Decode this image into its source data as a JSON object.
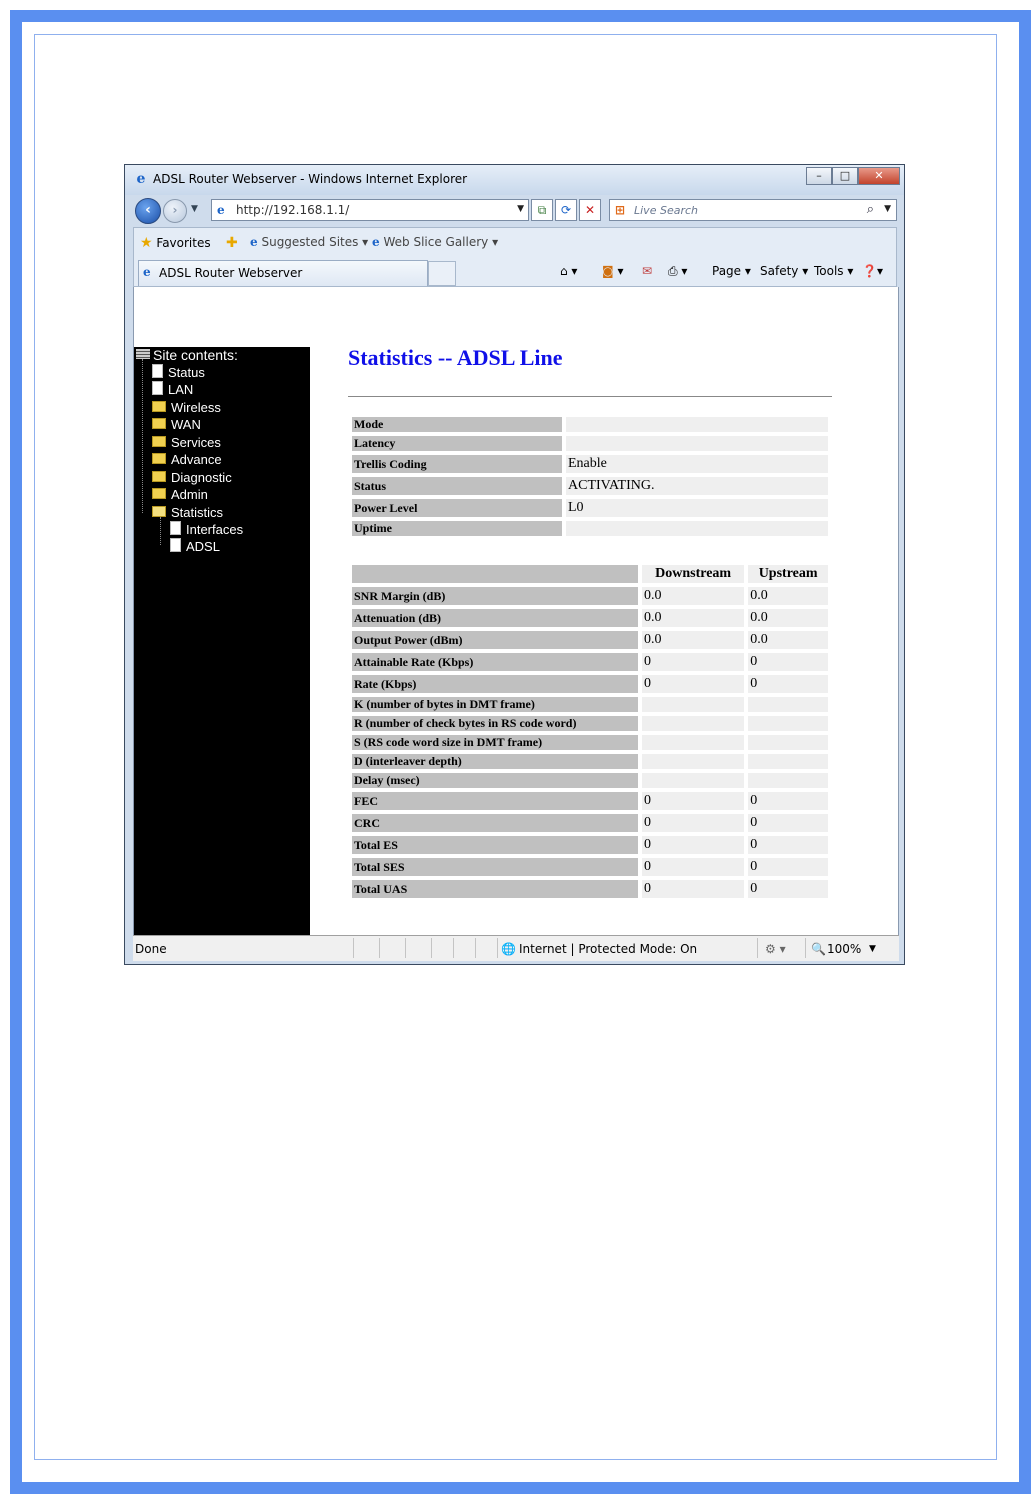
{
  "window": {
    "title": "ADSL Router Webserver - Windows Internet Explorer",
    "controls": {
      "minimize": "–",
      "maximize": "□",
      "close": "✕"
    }
  },
  "nav": {
    "address": "http://192.168.1.1/",
    "search_placeholder": "Live Search"
  },
  "favorites": {
    "favorites_label": "Favorites",
    "suggested_sites": "Suggested Sites ▾",
    "web_slice_gallery": "Web Slice Gallery ▾",
    "tab_title": "ADSL Router Webserver"
  },
  "commandbar": {
    "page": "Page ▾",
    "safety": "Safety ▾",
    "tools": "Tools ▾"
  },
  "sidebar": {
    "header": "Site contents:",
    "items": [
      {
        "label": "Status",
        "icon": "document"
      },
      {
        "label": "LAN",
        "icon": "document"
      },
      {
        "label": "Wireless",
        "icon": "folder"
      },
      {
        "label": "WAN",
        "icon": "folder"
      },
      {
        "label": "Services",
        "icon": "folder"
      },
      {
        "label": "Advance",
        "icon": "folder"
      },
      {
        "label": "Diagnostic",
        "icon": "folder"
      },
      {
        "label": "Admin",
        "icon": "folder"
      },
      {
        "label": "Statistics",
        "icon": "folder-open"
      },
      {
        "label": "Interfaces",
        "icon": "document"
      },
      {
        "label": "ADSL",
        "icon": "document"
      }
    ]
  },
  "main": {
    "title": "Statistics -- ADSL Line",
    "line_info": [
      {
        "label": "Mode",
        "value": ""
      },
      {
        "label": "Latency",
        "value": ""
      },
      {
        "label": "Trellis Coding",
        "value": "Enable"
      },
      {
        "label": "Status",
        "value": "ACTIVATING."
      },
      {
        "label": "Power Level",
        "value": "L0"
      },
      {
        "label": "Uptime",
        "value": ""
      }
    ],
    "stats_headers": {
      "downstream": "Downstream",
      "upstream": "Upstream"
    },
    "stats": [
      {
        "label": "SNR Margin (dB)",
        "down": "0.0",
        "up": "0.0"
      },
      {
        "label": "Attenuation (dB)",
        "down": "0.0",
        "up": "0.0"
      },
      {
        "label": "Output Power (dBm)",
        "down": "0.0",
        "up": "0.0"
      },
      {
        "label": "Attainable Rate (Kbps)",
        "down": "0",
        "up": "0"
      },
      {
        "label": "Rate (Kbps)",
        "down": "0",
        "up": "0"
      },
      {
        "label": "K (number of bytes in DMT frame)",
        "down": "",
        "up": ""
      },
      {
        "label": "R (number of check bytes in RS code word)",
        "down": "",
        "up": ""
      },
      {
        "label": "S (RS code word size in DMT frame)",
        "down": "",
        "up": ""
      },
      {
        "label": "D (interleaver depth)",
        "down": "",
        "up": ""
      },
      {
        "label": "Delay (msec)",
        "down": "",
        "up": ""
      },
      {
        "label": "FEC",
        "down": "0",
        "up": "0"
      },
      {
        "label": "CRC",
        "down": "0",
        "up": "0"
      },
      {
        "label": "Total ES",
        "down": "0",
        "up": "0"
      },
      {
        "label": "Total SES",
        "down": "0",
        "up": "0"
      },
      {
        "label": "Total UAS",
        "down": "0",
        "up": "0"
      }
    ]
  },
  "statusbar": {
    "done": "Done",
    "zone": "Internet | Protected Mode: On",
    "zoom": "100%"
  },
  "colors": {
    "page_frame": "#5a8ff0",
    "title_blue": "#1010e8",
    "label_gray": "#c0c0c0",
    "value_gray": "#efefef",
    "sidebar_bg": "#000000"
  }
}
